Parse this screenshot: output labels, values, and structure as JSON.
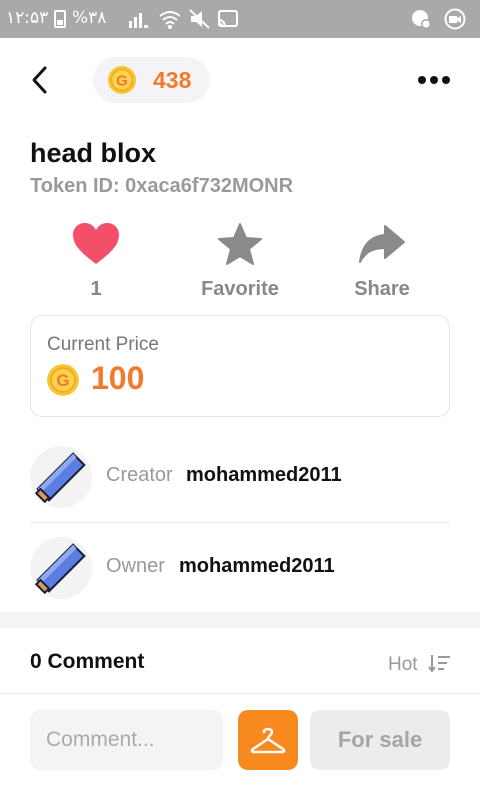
{
  "status_bar": {
    "time": "۱۲:۵۳",
    "battery_percent": "%۳۸",
    "icons": [
      "battery-icon",
      "signal-icon",
      "wifi-icon",
      "mute-icon",
      "cast-icon",
      "notification-icon",
      "camera-icon"
    ]
  },
  "header": {
    "coin_balance": "438",
    "icons": [
      "back-arrow-icon",
      "coin-icon",
      "more-icon"
    ]
  },
  "nft": {
    "title": "head blox",
    "token_id": "Token ID: 0xaca6f732MONR"
  },
  "actions": {
    "like_count": "1",
    "favorite_label": "Favorite",
    "share_label": "Share"
  },
  "price": {
    "label": "Current Price",
    "value": "100"
  },
  "creator": {
    "role_label": "Creator",
    "username": "mohammed2011"
  },
  "owner": {
    "role_label": "Owner",
    "username": "mohammed2011"
  },
  "comments": {
    "count_label": "0 Comment",
    "sort_label": "Hot"
  },
  "bottom_bar": {
    "comment_placeholder": "Comment...",
    "for_sale_label": "For sale"
  },
  "colors": {
    "accent_orange": "#f07b2b",
    "button_orange": "#f7891f",
    "heart_red": "#f44f6a",
    "coin_gold": "#f7c531",
    "muted_gray": "#999999"
  }
}
